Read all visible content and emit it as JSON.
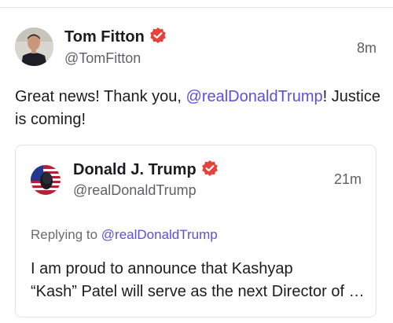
{
  "post": {
    "author_name": "Tom Fitton",
    "author_handle": "@TomFitton",
    "timestamp": "8m",
    "text_before": "Great news! Thank you, ",
    "mention": "@realDonaldTrump",
    "text_after": "! Justice is coming!"
  },
  "quote": {
    "author_name": "Donald J. Trump",
    "author_handle": "@realDonaldTrump",
    "timestamp": "21m",
    "replying_label": "Replying to ",
    "replying_handle": "@realDonaldTrump",
    "text_line1": "I am proud to announce that Kashyap",
    "text_line2": "“Kash” Patel will serve as the next Director of the Federal Bureau of Investigation."
  },
  "colors": {
    "mention": "#5b4fe0",
    "verified_badge": "#e5423c",
    "secondary_text": "#5f5f66"
  },
  "icons": {
    "verified": "verified-badge-icon"
  }
}
